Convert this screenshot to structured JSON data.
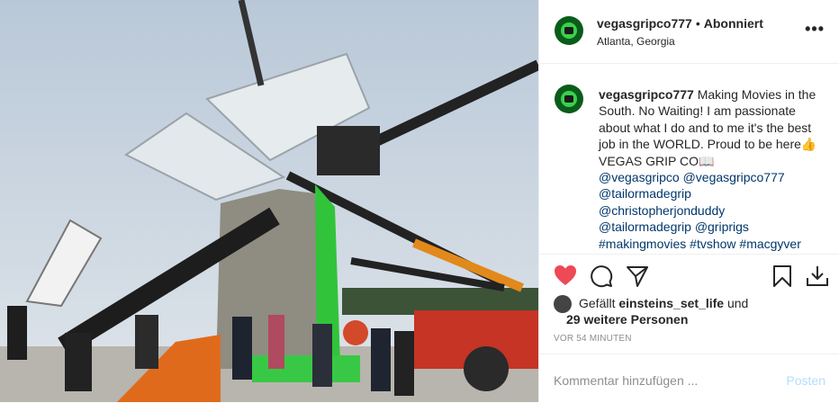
{
  "post": {
    "username": "vegasgripco777",
    "separator": "•",
    "follow_status": "Abonniert",
    "location": "Atlanta, Georgia",
    "more_label": "•••",
    "caption_text": "Making Movies in the South. No Waiting! I am passionate about what I do and to me it's the best job in the WORLD. Proud to be here👍 VEGAS GRIP CO📖",
    "hashtags": [
      "@vegasgripco",
      "@vegasgripco777",
      "@tailormadegrip",
      "@christopherjonduddy",
      "@tailormadegrip",
      "@griprigs",
      "#makingmovies",
      "#tvshow",
      "#macgyver"
    ],
    "likes_prefix": "Gefällt",
    "liked_by": "einsteins_set_life",
    "likes_and": "und",
    "likes_others": "29 weitere Personen",
    "time_ago": "VOR 54 MINUTEN",
    "comment_placeholder": "Kommentar hinzufügen ...",
    "post_button": "Posten"
  },
  "icons": [
    "heart-icon",
    "comment-icon",
    "share-icon",
    "bookmark-icon",
    "download-icon"
  ],
  "colors": {
    "heart": "#ed4956",
    "link": "#00376b",
    "post_disabled": "#b2dffc",
    "meta": "#8e8e8e"
  }
}
